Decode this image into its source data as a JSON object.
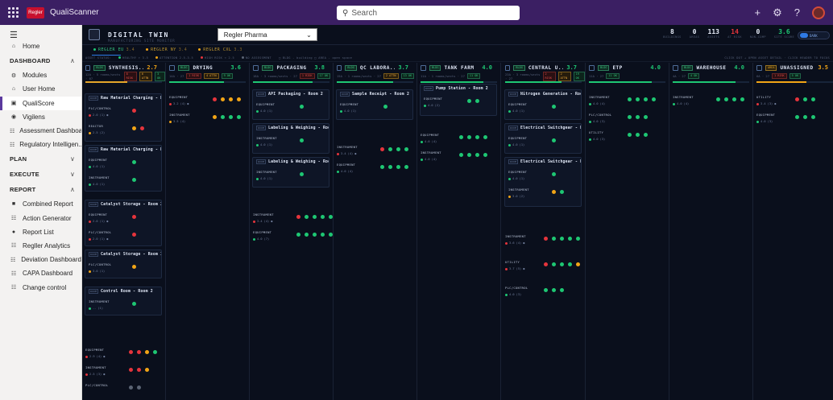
{
  "topbar": {
    "app_name": "QualiScanner",
    "logo_text": "Regler",
    "search_placeholder": "Search",
    "icons": [
      "waffle-icon",
      "plus-icon",
      "gear-icon",
      "help-icon"
    ]
  },
  "sidebar": {
    "items_top": [
      {
        "label": "Home",
        "icon": "home-icon"
      }
    ],
    "sections": [
      {
        "label": "DASHBOARD",
        "expanded": true,
        "items": [
          {
            "label": "Modules",
            "icon": "modules-icon"
          },
          {
            "label": "User Home",
            "icon": "user-home-icon"
          },
          {
            "label": "QualiScore",
            "icon": "qualiscore-icon",
            "active": true
          },
          {
            "label": "Vigilens",
            "icon": "vigilens-icon"
          },
          {
            "label": "Assessment Dashboa...",
            "icon": "assessment-icon"
          },
          {
            "label": "Regulatory Intelligen...",
            "icon": "regulatory-icon"
          }
        ]
      },
      {
        "label": "PLAN",
        "expanded": false,
        "items": []
      },
      {
        "label": "EXECUTE",
        "expanded": false,
        "items": []
      },
      {
        "label": "REPORT",
        "expanded": true,
        "items": [
          {
            "label": "Combined Report",
            "icon": "report-icon"
          },
          {
            "label": "Action Generator",
            "icon": "action-icon"
          },
          {
            "label": "Report List",
            "icon": "list-icon"
          },
          {
            "label": "Regller Analytics",
            "icon": "analytics-icon"
          },
          {
            "label": "Deviation Dashboard",
            "icon": "deviation-icon"
          },
          {
            "label": "CAPA Dashboard",
            "icon": "capa-icon"
          },
          {
            "label": "Change control",
            "icon": "change-icon"
          }
        ]
      }
    ]
  },
  "main": {
    "title": "DIGITAL TWIN",
    "subtitle": "MANUFACTURING SITE MONITOR",
    "site_select": "Regler Pharma",
    "stats": [
      {
        "value": "8",
        "label": "BUILDINGS",
        "color": "#e6ecf8"
      },
      {
        "value": "0",
        "label": "AREAS",
        "color": "#e6ecf8"
      },
      {
        "value": "113",
        "label": "ASSETS",
        "color": "#e6ecf8"
      },
      {
        "value": "14",
        "label": "AT RISK",
        "color": "#e5343c"
      },
      {
        "value": "0",
        "label": "NON-COMP",
        "color": "#e6ecf8"
      },
      {
        "value": "3.6",
        "label": "SITE SCORE",
        "color": "#1ec773"
      }
    ],
    "toggle_label": "DARK",
    "sites": [
      {
        "label": "REGLER EU",
        "score": "3.4",
        "dot": "#1ec773"
      },
      {
        "label": "REGLER NY",
        "score": "3.4",
        "dot": "#f2a516"
      },
      {
        "label": "REGLER CXL",
        "score": "3.3",
        "dot": "#f2a516"
      }
    ],
    "legend": [
      {
        "label": "ASSET STATUS:",
        "color": ""
      },
      {
        "label": "HEALTHY > 3.5",
        "color": "#1ec773"
      },
      {
        "label": "ATTENTION 2.5-3.5",
        "color": "#f2a516"
      },
      {
        "label": "HIGH RISK < 2.5",
        "color": "#e5343c"
      },
      {
        "label": "NO ASSESSMENT",
        "color": "#5b6474"
      },
      {
        "label": "□ BLDG - building  □ AREA - open space",
        "color": ""
      }
    ],
    "legend_right": "CLICK DOT → OPEN ASSET DETAIL · CLICK HEADER TO FOCUS",
    "columns": [
      {
        "name": "SYNTHESIS...",
        "kind": "BLDG",
        "score": "2.7",
        "score_color": "#f2a516",
        "sub": "12A · 5 rooms/sects · 07",
        "tags": [
          {
            "t": "8 RISK",
            "c": "r"
          },
          {
            "t": "6 ATTN",
            "c": "a"
          },
          {
            "t": "3 OK",
            "c": "g"
          }
        ],
        "bar": 0.55,
        "bar_color": "#e5a62a"
      },
      {
        "name": "DRYING",
        "kind": "BLDG",
        "score": "3.6",
        "score_color": "#1ec773",
        "sub": "14A · 27",
        "tags": [
          {
            "t": "1 RISK",
            "c": "r"
          },
          {
            "t": "4 ATTN",
            "c": "a"
          },
          {
            "t": "9 OK",
            "c": "g"
          }
        ],
        "bar": 0.72,
        "bar_color": "#1ec773"
      },
      {
        "name": "PACKAGING",
        "kind": "BLDG",
        "score": "3.8",
        "score_color": "#1ec773",
        "sub": "18A · 3 rooms/sects · 27",
        "tags": [
          {
            "t": "1 RISK",
            "c": "r"
          },
          {
            "t": "17 OK",
            "c": "g"
          }
        ],
        "bar": 0.78,
        "bar_color": "#1ec773"
      },
      {
        "name": "QC LABORA...",
        "kind": "BLDG",
        "score": "3.7",
        "score_color": "#1ec773",
        "sub": "15A · 1 rooms/sects · 27",
        "tags": [
          {
            "t": "2 ATTN",
            "c": "a"
          },
          {
            "t": "13 OK",
            "c": "g"
          }
        ],
        "bar": 0.74,
        "bar_color": "#1ec773"
      },
      {
        "name": "TANK FARM",
        "kind": "BLDG",
        "score": "4.0",
        "score_color": "#1ec773",
        "sub": "11A · 1 rooms/sects · 27",
        "tags": [
          {
            "t": "11 OK",
            "c": "g"
          }
        ],
        "bar": 0.82,
        "bar_color": "#1ec773"
      },
      {
        "name": "CENTRAL U...",
        "kind": "BLDG",
        "score": "3.7",
        "score_color": "#1ec773",
        "sub": "23A · 3 rooms/sects · 27",
        "tags": [
          {
            "t": "2 RISK",
            "c": "r"
          },
          {
            "t": "2 ATTN",
            "c": "a"
          },
          {
            "t": "19 OK",
            "c": "g"
          }
        ],
        "bar": 0.74,
        "bar_color": "#1ec773"
      },
      {
        "name": "ETP",
        "kind": "BLDG",
        "score": "4.0",
        "score_color": "#1ec773",
        "sub": "11A · 27",
        "tags": [
          {
            "t": "11 OK",
            "c": "g"
          }
        ],
        "bar": 0.82,
        "bar_color": "#1ec773"
      },
      {
        "name": "WAREHOUSE",
        "kind": "BLDG",
        "score": "4.0",
        "score_color": "#1ec773",
        "sub": "4A · 27",
        "tags": [
          {
            "t": "4 OK",
            "c": "g"
          }
        ],
        "bar": 0.82,
        "bar_color": "#1ec773"
      },
      {
        "name": "UNASSIGNED",
        "kind": "AREA",
        "score": "3.5",
        "score_color": "#f2a516",
        "sub": "6A · 27",
        "tags": [
          {
            "t": "1 RISK",
            "c": "r"
          },
          {
            "t": "5 OK",
            "c": "g"
          }
        ],
        "bar": 0.65,
        "bar_color": "#f2a516"
      }
    ]
  },
  "column_content": {
    "c0": {
      "room1": "Raw Material Charging - Ro",
      "room1_rows": [
        {
          "label": "PLC/CONTROL",
          "stat": "2.0 (1) ●",
          "dots": [
            "red"
          ]
        },
        {
          "label": "REACTOR",
          "stat": "2.5 (2)",
          "dots": [
            "amb",
            "red"
          ]
        }
      ],
      "room2": "Raw Material Charging - Ro",
      "room2_rows": [
        {
          "label": "EQUIPMENT",
          "stat": "4.0 (1)",
          "dots": [
            "grn"
          ]
        },
        {
          "label": "INSTRUMENT",
          "stat": "4.0 (1)",
          "dots": [
            "grn"
          ]
        }
      ],
      "room3": "Catalyst Storage - Room 2",
      "room3_rows": [
        {
          "label": "EQUIPMENT",
          "stat": "2.0 (1) ●",
          "dots": [
            "red"
          ]
        },
        {
          "label": "PLC/CONTROL",
          "stat": "2.0 (1) ●",
          "dots": [
            "red"
          ]
        }
      ],
      "room4": "Catalyst Storage - Room 3",
      "room4_rows": [
        {
          "label": "PLC/CONTROL",
          "stat": "3.0 (1)",
          "dots": [
            "amb"
          ]
        }
      ],
      "room5": "Control Room - Room 2",
      "room5_rows": [
        {
          "label": "INSTRUMENT",
          "stat": "-- (1)",
          "dots": [
            "grn"
          ]
        }
      ],
      "loose_rows": [
        {
          "label": "EQUIPMENT",
          "stat": "2.9 (4) ●",
          "dots": [
            "red",
            "red",
            "amb",
            "grn"
          ]
        },
        {
          "label": "INSTRUMENT",
          "stat": "2.5 (3) ●",
          "dots": [
            "red",
            "red",
            "amb"
          ]
        },
        {
          "label": "PLC/CONTROL",
          "stat": "",
          "dots": [
            "gry",
            "gry"
          ]
        }
      ]
    },
    "c1": {
      "rows": [
        {
          "label": "EQUIPMENT",
          "stat": "3.2 (4) ●",
          "dots": [
            "red",
            "amb",
            "amb",
            "amb"
          ]
        },
        {
          "label": "INSTRUMENT",
          "stat": "3.5 (4)",
          "dots": [
            "amb",
            "grn",
            "grn",
            "grn"
          ]
        }
      ]
    },
    "c2": {
      "room1": "API Packaging - Room 2",
      "room1_rows": [
        {
          "label": "EQUIPMENT",
          "stat": "4.0 (1)",
          "dots": [
            "grn"
          ]
        }
      ],
      "room2": "Labeling & Weighing - Room",
      "room2_rows": [
        {
          "label": "INSTRUMENT",
          "stat": "4.0 (1)",
          "dots": [
            "grn"
          ]
        }
      ],
      "room3": "Labeling & Weighing - Room",
      "room3_rows": [
        {
          "label": "INSTRUMENT",
          "stat": "4.0 (1)",
          "dots": [
            "grn"
          ]
        }
      ],
      "loose_rows": [
        {
          "label": "INSTRUMENT",
          "stat": "3.4 (4) ●",
          "dots": [
            "red",
            "grn",
            "grn",
            "grn",
            "grn"
          ]
        },
        {
          "label": "EQUIPMENT",
          "stat": "4.0 (7)",
          "dots": [
            "grn",
            "grn",
            "grn",
            "grn",
            "grn",
            "grn",
            "grn"
          ]
        }
      ]
    },
    "c3": {
      "room1": "Sample Receipt - Room 2",
      "room1_rows": [
        {
          "label": "EQUIPMENT",
          "stat": "4.0 (1)",
          "dots": [
            "grn"
          ]
        }
      ],
      "loose_rows": [
        {
          "label": "INSTRUMENT",
          "stat": "3.4 (4) ●",
          "dots": [
            "red",
            "grn",
            "grn",
            "grn"
          ]
        },
        {
          "label": "EQUIPMENT",
          "stat": "4.0 (4)",
          "dots": [
            "grn",
            "grn",
            "grn",
            "grn"
          ]
        }
      ]
    },
    "c4": {
      "room1": "Pump Station - Room 2",
      "room1_rows": [
        {
          "label": "EQUIPMENT",
          "stat": "4.0 (2)",
          "dots": [
            "grn",
            "grn"
          ]
        }
      ],
      "loose_rows": [
        {
          "label": "EQUIPMENT",
          "stat": "4.0 (4)",
          "dots": [
            "grn",
            "grn",
            "grn",
            "grn"
          ]
        },
        {
          "label": "INSTRUMENT",
          "stat": "4.0 (4)",
          "dots": [
            "grn",
            "grn",
            "grn",
            "grn"
          ]
        }
      ]
    },
    "c5": {
      "room1": "Nitrogen Generation - Room",
      "room1_rows": [
        {
          "label": "EQUIPMENT",
          "stat": "4.0 (1)",
          "dots": [
            "grn"
          ]
        }
      ],
      "room2": "Electrical Switchgear - Ro",
      "room2_rows": [
        {
          "label": "EQUIPMENT",
          "stat": "4.0 (1)",
          "dots": [
            "grn"
          ]
        }
      ],
      "room3": "Electrical Switchgear - Ro",
      "room3_rows": [
        {
          "label": "EQUIPMENT",
          "stat": "4.0 (1)",
          "dots": [
            "grn"
          ]
        },
        {
          "label": "INSTRUMENT",
          "stat": "3.0 (2)",
          "dots": [
            "amb",
            "grn"
          ]
        }
      ],
      "loose_rows": [
        {
          "label": "INSTRUMENT",
          "stat": "3.6 (4) ●",
          "dots": [
            "red",
            "grn",
            "grn",
            "grn",
            "grn"
          ]
        },
        {
          "label": "UTILITY",
          "stat": "3.7 (5) ●",
          "dots": [
            "red",
            "grn",
            "grn",
            "grn",
            "amb"
          ]
        },
        {
          "label": "PLC/CONTROL",
          "stat": "4.0 (3)",
          "dots": [
            "grn",
            "grn",
            "grn"
          ]
        }
      ]
    },
    "c6": {
      "rows": [
        {
          "label": "INSTRUMENT",
          "stat": "4.0 (4)",
          "dots": [
            "grn",
            "grn",
            "grn",
            "grn"
          ]
        },
        {
          "label": "PLC/CONTROL",
          "stat": "4.0 (3)",
          "dots": [
            "grn",
            "grn",
            "grn"
          ]
        },
        {
          "label": "UTILITY",
          "stat": "4.0 (3)",
          "dots": [
            "grn",
            "grn",
            "grn"
          ]
        }
      ]
    },
    "c7": {
      "rows": [
        {
          "label": "INSTRUMENT",
          "stat": "4.0 (4)",
          "dots": [
            "grn",
            "grn",
            "grn",
            "grn"
          ]
        }
      ]
    },
    "c8": {
      "rows": [
        {
          "label": "UTILITY",
          "stat": "3.4 (3) ●",
          "dots": [
            "red",
            "grn",
            "grn"
          ]
        },
        {
          "label": "EQUIPMENT",
          "stat": "4.0 (3)",
          "dots": [
            "grn",
            "grn",
            "grn"
          ]
        }
      ]
    }
  }
}
